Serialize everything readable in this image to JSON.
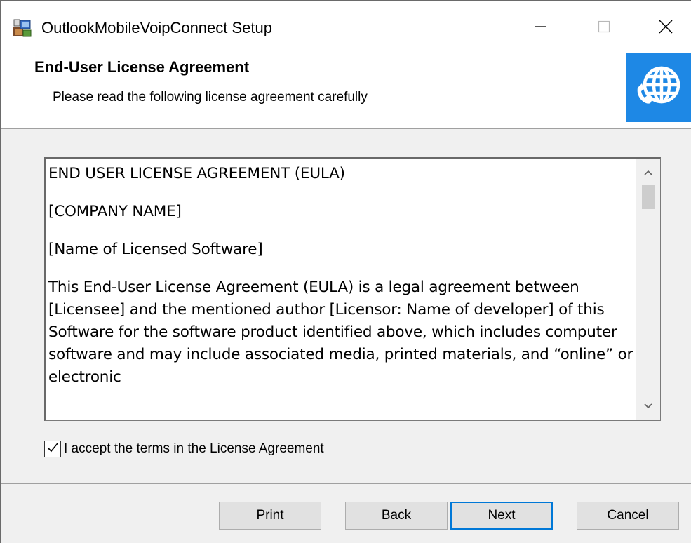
{
  "window": {
    "title": "OutlookMobileVoipConnect Setup",
    "icons": {
      "app": "installer-icon",
      "minimize": "minimize-icon",
      "maximize": "maximize-icon",
      "close": "close-icon"
    }
  },
  "header": {
    "title": "End-User License Agreement",
    "subtitle": "Please read the following license agreement carefully",
    "logo_icon": "globe-phone-icon",
    "logo_color": "#1e88e5"
  },
  "license": {
    "paragraphs": [
      "END USER LICENSE AGREEMENT (EULA)",
      "[COMPANY NAME]",
      "[Name of Licensed Software]",
      "This End-User License Agreement (EULA) is a legal agreement between [Licensee] and the mentioned author [Licensor: Name of developer] of this Software for the software product identified above, which includes computer software and may include associated media, printed materials, and “online” or electronic"
    ]
  },
  "accept": {
    "label": "I accept the terms in the License Agreement",
    "checked": true
  },
  "buttons": {
    "print": "Print",
    "back": "Back",
    "next": "Next",
    "cancel": "Cancel"
  },
  "colors": {
    "accent": "#0078d7",
    "button_bg": "#e1e1e1",
    "window_bg": "#f0f0f0"
  }
}
